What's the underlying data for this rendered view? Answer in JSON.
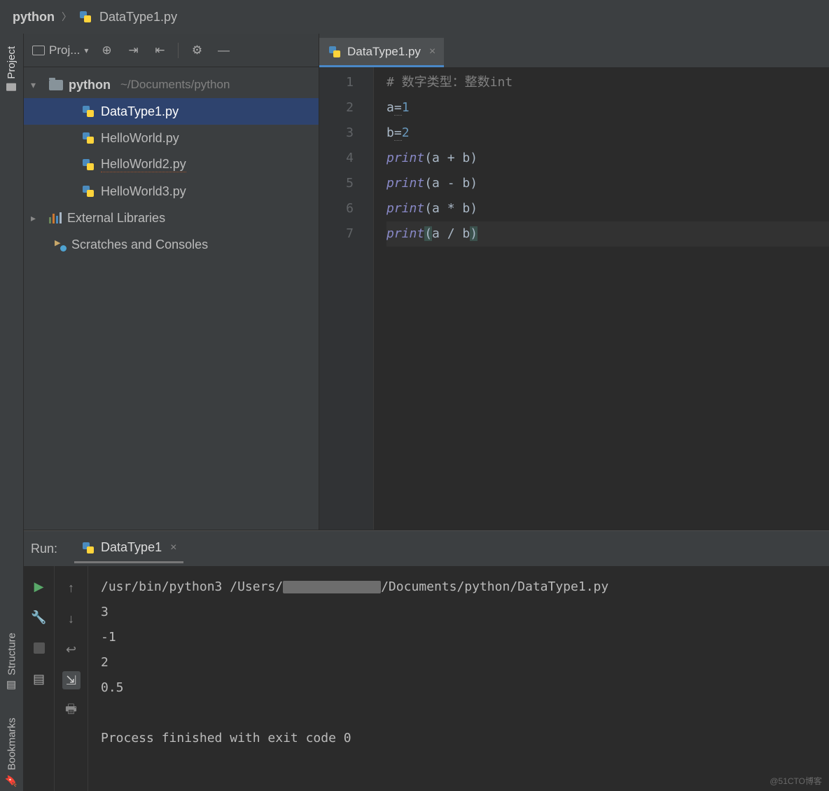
{
  "breadcrumb": {
    "root": "python",
    "file": "DataType1.py"
  },
  "leftbar": {
    "project": "Project",
    "structure": "Structure",
    "bookmarks": "Bookmarks"
  },
  "projectPanel": {
    "title": "Proj...",
    "tree": {
      "root": {
        "name": "python",
        "path": "~/Documents/python"
      },
      "files": [
        "DataType1.py",
        "HelloWorld.py",
        "HelloWorld2.py",
        "HelloWorld3.py"
      ],
      "external": "External Libraries",
      "scratches": "Scratches and Consoles"
    }
  },
  "editor": {
    "tab": "DataType1.py",
    "lines": {
      "l1_comment": "# 数字类型：整数int",
      "l2a": "a",
      "l2eq": "=",
      "l2v": "1",
      "l3a": "b",
      "l3eq": "=",
      "l3v": "2",
      "l4k": "print",
      "l4p1": "(",
      "l4a": "a + b",
      "l4p2": ")",
      "l5k": "print",
      "l5p1": "(",
      "l5a": "a - b",
      "l5p2": ")",
      "l6k": "print",
      "l6p1": "(",
      "l6a": "a * b",
      "l6p2": ")",
      "l7k": "print",
      "l7p1": "(",
      "l7a": "a / b",
      "l7p2": ")"
    },
    "gutter": [
      "1",
      "2",
      "3",
      "4",
      "5",
      "6",
      "7"
    ]
  },
  "run": {
    "label": "Run:",
    "tab": "DataType1",
    "cmd_pre": "/usr/bin/python3 /Users/",
    "cmd_post": "/Documents/python/DataType1.py",
    "out": [
      "3",
      "-1",
      "2",
      "0.5"
    ],
    "exit": "Process finished with exit code 0"
  },
  "watermark": "@51CTO博客"
}
